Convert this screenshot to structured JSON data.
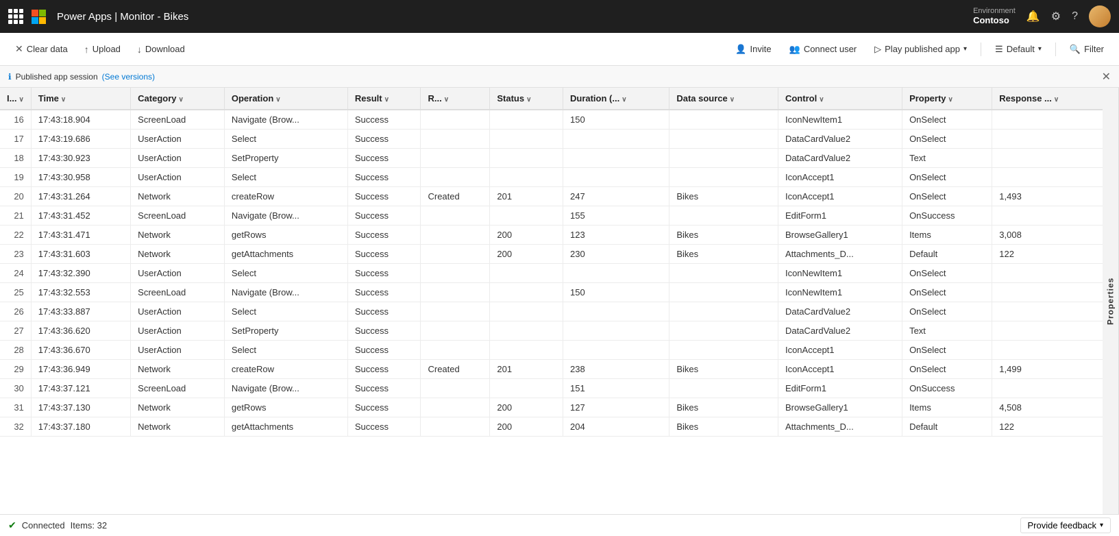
{
  "topbar": {
    "title": "Power Apps | Monitor - Bikes",
    "environment_label": "Environment",
    "environment_name": "Contoso"
  },
  "toolbar": {
    "clear_label": "Clear data",
    "upload_label": "Upload",
    "download_label": "Download",
    "invite_label": "Invite",
    "connect_user_label": "Connect user",
    "play_published_app_label": "Play published app",
    "default_label": "Default",
    "filter_label": "Filter"
  },
  "session": {
    "text": "Published app session",
    "link_text": "(See versions)"
  },
  "columns": [
    {
      "key": "id",
      "label": "I..."
    },
    {
      "key": "time",
      "label": "Time"
    },
    {
      "key": "category",
      "label": "Category"
    },
    {
      "key": "operation",
      "label": "Operation"
    },
    {
      "key": "result",
      "label": "Result"
    },
    {
      "key": "r",
      "label": "R..."
    },
    {
      "key": "status",
      "label": "Status"
    },
    {
      "key": "duration",
      "label": "Duration (..."
    },
    {
      "key": "datasource",
      "label": "Data source"
    },
    {
      "key": "control",
      "label": "Control"
    },
    {
      "key": "property",
      "label": "Property"
    },
    {
      "key": "response",
      "label": "Response ..."
    }
  ],
  "rows": [
    {
      "id": 16,
      "time": "17:43:18.904",
      "category": "ScreenLoad",
      "operation": "Navigate (Brow...",
      "result": "Success",
      "r": "",
      "status": "",
      "duration": "150",
      "datasource": "",
      "control": "IconNewItem1",
      "property": "OnSelect",
      "response": ""
    },
    {
      "id": 17,
      "time": "17:43:19.686",
      "category": "UserAction",
      "operation": "Select",
      "result": "Success",
      "r": "",
      "status": "",
      "duration": "",
      "datasource": "",
      "control": "DataCardValue2",
      "property": "OnSelect",
      "response": ""
    },
    {
      "id": 18,
      "time": "17:43:30.923",
      "category": "UserAction",
      "operation": "SetProperty",
      "result": "Success",
      "r": "",
      "status": "",
      "duration": "",
      "datasource": "",
      "control": "DataCardValue2",
      "property": "Text",
      "response": ""
    },
    {
      "id": 19,
      "time": "17:43:30.958",
      "category": "UserAction",
      "operation": "Select",
      "result": "Success",
      "r": "",
      "status": "",
      "duration": "",
      "datasource": "",
      "control": "IconAccept1",
      "property": "OnSelect",
      "response": ""
    },
    {
      "id": 20,
      "time": "17:43:31.264",
      "category": "Network",
      "operation": "createRow",
      "result": "Success",
      "r": "Created",
      "status": "201",
      "duration": "247",
      "datasource": "Bikes",
      "control": "IconAccept1",
      "property": "OnSelect",
      "response": "1,493"
    },
    {
      "id": 21,
      "time": "17:43:31.452",
      "category": "ScreenLoad",
      "operation": "Navigate (Brow...",
      "result": "Success",
      "r": "",
      "status": "",
      "duration": "155",
      "datasource": "",
      "control": "EditForm1",
      "property": "OnSuccess",
      "response": ""
    },
    {
      "id": 22,
      "time": "17:43:31.471",
      "category": "Network",
      "operation": "getRows",
      "result": "Success",
      "r": "",
      "status": "200",
      "duration": "123",
      "datasource": "Bikes",
      "control": "BrowseGallery1",
      "property": "Items",
      "response": "3,008"
    },
    {
      "id": 23,
      "time": "17:43:31.603",
      "category": "Network",
      "operation": "getAttachments",
      "result": "Success",
      "r": "",
      "status": "200",
      "duration": "230",
      "datasource": "Bikes",
      "control": "Attachments_D...",
      "property": "Default",
      "response": "122"
    },
    {
      "id": 24,
      "time": "17:43:32.390",
      "category": "UserAction",
      "operation": "Select",
      "result": "Success",
      "r": "",
      "status": "",
      "duration": "",
      "datasource": "",
      "control": "IconNewItem1",
      "property": "OnSelect",
      "response": ""
    },
    {
      "id": 25,
      "time": "17:43:32.553",
      "category": "ScreenLoad",
      "operation": "Navigate (Brow...",
      "result": "Success",
      "r": "",
      "status": "",
      "duration": "150",
      "datasource": "",
      "control": "IconNewItem1",
      "property": "OnSelect",
      "response": ""
    },
    {
      "id": 26,
      "time": "17:43:33.887",
      "category": "UserAction",
      "operation": "Select",
      "result": "Success",
      "r": "",
      "status": "",
      "duration": "",
      "datasource": "",
      "control": "DataCardValue2",
      "property": "OnSelect",
      "response": ""
    },
    {
      "id": 27,
      "time": "17:43:36.620",
      "category": "UserAction",
      "operation": "SetProperty",
      "result": "Success",
      "r": "",
      "status": "",
      "duration": "",
      "datasource": "",
      "control": "DataCardValue2",
      "property": "Text",
      "response": ""
    },
    {
      "id": 28,
      "time": "17:43:36.670",
      "category": "UserAction",
      "operation": "Select",
      "result": "Success",
      "r": "",
      "status": "",
      "duration": "",
      "datasource": "",
      "control": "IconAccept1",
      "property": "OnSelect",
      "response": ""
    },
    {
      "id": 29,
      "time": "17:43:36.949",
      "category": "Network",
      "operation": "createRow",
      "result": "Success",
      "r": "Created",
      "status": "201",
      "duration": "238",
      "datasource": "Bikes",
      "control": "IconAccept1",
      "property": "OnSelect",
      "response": "1,499"
    },
    {
      "id": 30,
      "time": "17:43:37.121",
      "category": "ScreenLoad",
      "operation": "Navigate (Brow...",
      "result": "Success",
      "r": "",
      "status": "",
      "duration": "151",
      "datasource": "",
      "control": "EditForm1",
      "property": "OnSuccess",
      "response": ""
    },
    {
      "id": 31,
      "time": "17:43:37.130",
      "category": "Network",
      "operation": "getRows",
      "result": "Success",
      "r": "",
      "status": "200",
      "duration": "127",
      "datasource": "Bikes",
      "control": "BrowseGallery1",
      "property": "Items",
      "response": "4,508"
    },
    {
      "id": 32,
      "time": "17:43:37.180",
      "category": "Network",
      "operation": "getAttachments",
      "result": "Success",
      "r": "",
      "status": "200",
      "duration": "204",
      "datasource": "Bikes",
      "control": "Attachments_D...",
      "property": "Default",
      "response": "122"
    }
  ],
  "status": {
    "connected_text": "Connected",
    "items_text": "Items: 32",
    "feedback_label": "Provide feedback"
  },
  "side_panel": {
    "label": "Properties"
  }
}
